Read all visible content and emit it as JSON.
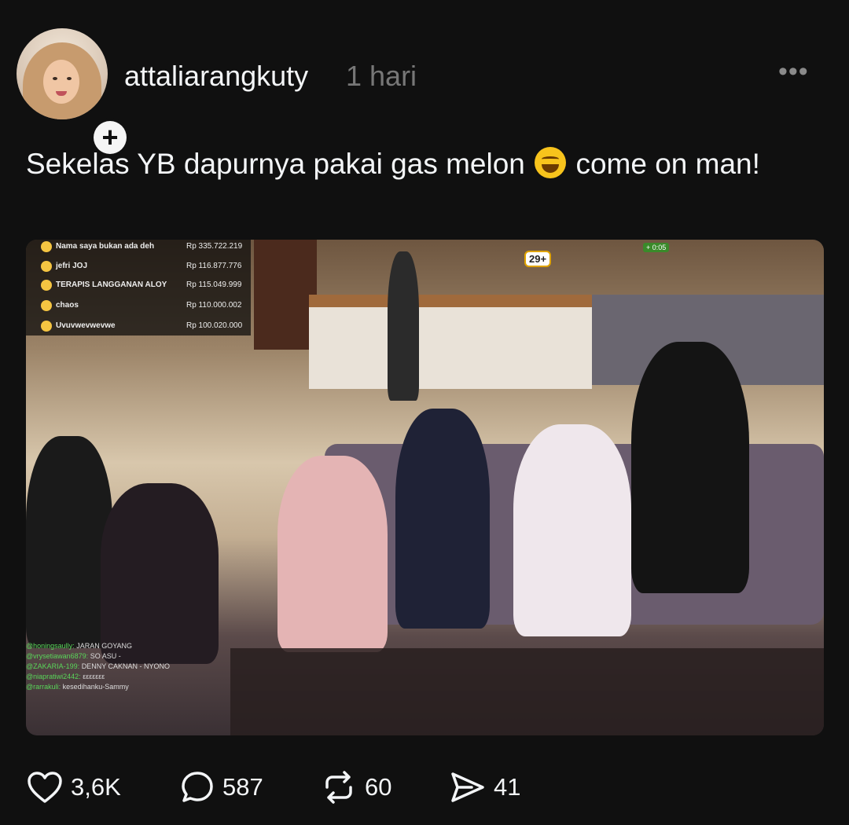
{
  "post": {
    "username": "attaliarangkuty",
    "time": "1 hari",
    "more_label": "•••",
    "text_before_emoji": "Sekelas YB dapurnya pakai gas melon",
    "emoji_icon": "rolling-on-floor-laughing-emoji",
    "text_after_emoji": "come on man!",
    "follow_label": "+"
  },
  "media": {
    "leaderboard": [
      {
        "name": "Nama saya bukan ada deh",
        "amount": "Rp 335.722.219"
      },
      {
        "name": "jefri JOJ",
        "amount": "Rp 116.877.776"
      },
      {
        "name": "TERAPIS LANGGANAN ALOY",
        "amount": "Rp 115.049.999"
      },
      {
        "name": "chaos",
        "amount": "Rp 110.000.002"
      },
      {
        "name": "Uvuvwevwevwe",
        "amount": "Rp 100.020.000"
      }
    ],
    "age_badge": "29+",
    "timer": "+ 0:05",
    "chat": [
      {
        "user": "@honingsaully:",
        "msg": "JARAN GOYANG"
      },
      {
        "user": "@vrysetiawan6879:",
        "msg": "SO ASU -"
      },
      {
        "user": "@ZAKARIA-199:",
        "msg": "DENNY CAKNAN - NYONO"
      },
      {
        "user": "@niapratiwi2442:",
        "msg": "εεεεεεε"
      },
      {
        "user": "@rarrakuli:",
        "msg": "kesedihanku-Sammy"
      }
    ]
  },
  "actions": {
    "likes": "3,6K",
    "comments": "587",
    "reposts": "60",
    "shares": "41"
  }
}
